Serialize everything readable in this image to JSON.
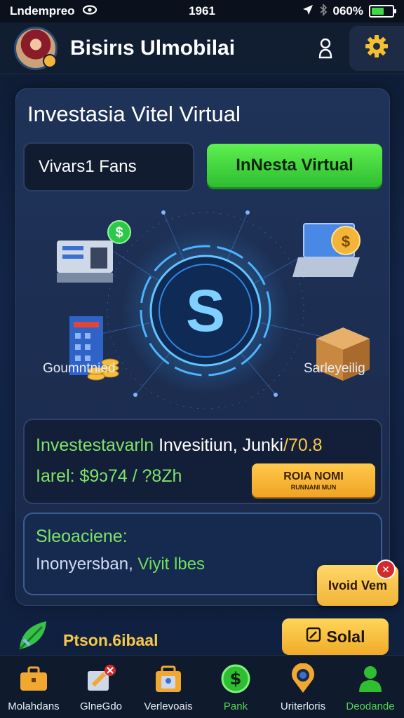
{
  "status_bar": {
    "carrier": "Lndempreo",
    "time": "1961",
    "battery": "060%",
    "battery_level": 0.6
  },
  "header": {
    "title": "Bisirıs Ulmobilai"
  },
  "card": {
    "title": "Investasia Vitel Virtual",
    "funds_label": "Vivars1 Fans",
    "invest_button": "InNesta Virtual"
  },
  "illustration": {
    "left_label": "Goumntnied",
    "right_label": "Sarleyeilig",
    "center_symbol": "S"
  },
  "info": {
    "line1_green": "Investestavarln",
    "line1_white": " Invesitiun,  Junki",
    "line1_accent": "/70.8",
    "line2": "Iarel: $9ↄ74 / ?8Zh",
    "button_line1": "ROIA NOMI",
    "button_line2": "RUNNANI MUN"
  },
  "scenario": {
    "title": "Sleoaciene:",
    "text_main": "Inonyersban,",
    "text_highlight": " Viyit lbes"
  },
  "tooltip": {
    "label": "Ivoid Vem"
  },
  "promo": {
    "label": "Ptson.6ibaal",
    "button": "Solal"
  },
  "nav": {
    "items": [
      {
        "label": "Molahdans",
        "icon": "briefcase-icon"
      },
      {
        "label": "GlneGdo",
        "icon": "edit-badge-icon"
      },
      {
        "label": "Verlevoais",
        "icon": "bag-icon"
      },
      {
        "label": "Pank",
        "icon": "dollar-icon"
      },
      {
        "label": "Uriterloris",
        "icon": "location-icon"
      },
      {
        "label": "Deodande",
        "icon": "profile-icon"
      }
    ]
  },
  "colors": {
    "accent_green": "#4fd64f",
    "accent_gold": "#f7c94b",
    "background": "#13264a"
  }
}
